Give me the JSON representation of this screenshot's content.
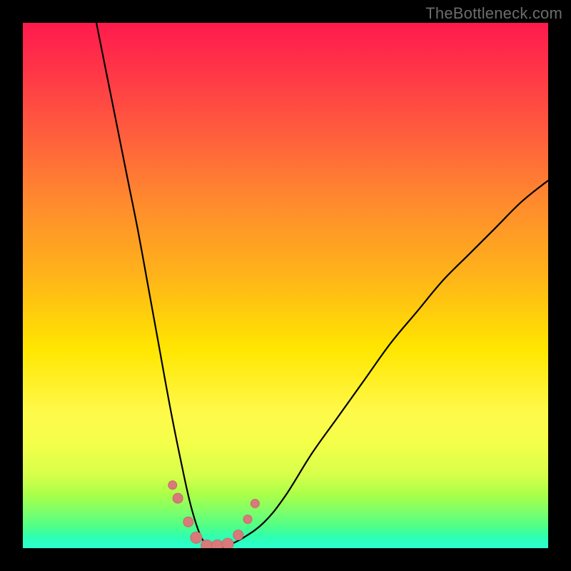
{
  "watermark": {
    "text": "TheBottleneck.com"
  },
  "colors": {
    "background": "#000000",
    "curve": "#000000",
    "marker_fill": "#d97a7a",
    "marker_stroke": "#c86a6a"
  },
  "chart_data": {
    "type": "line",
    "title": "",
    "xlabel": "",
    "ylabel": "",
    "xlim": [
      0,
      100
    ],
    "ylim": [
      0,
      100
    ],
    "grid": false,
    "legend": false,
    "notes": "Bottleneck-style V curve. Steep left arm and shallow right arm meeting near x≈35. High y = red/bad, low y (near 0) = green/good. No axis ticks or labels visible.",
    "series": [
      {
        "name": "left-arm",
        "x": [
          14,
          16,
          18,
          20,
          22,
          24,
          26,
          28,
          30,
          32,
          34,
          36,
          38
        ],
        "y": [
          100,
          90,
          80,
          70,
          60,
          49,
          38,
          27,
          17,
          8,
          2,
          0,
          0
        ]
      },
      {
        "name": "right-arm",
        "x": [
          38,
          42,
          46,
          50,
          55,
          60,
          65,
          70,
          75,
          80,
          85,
          90,
          95,
          100
        ],
        "y": [
          0,
          2,
          5,
          10,
          18,
          25,
          32,
          39,
          45,
          51,
          56,
          61,
          66,
          70
        ]
      }
    ],
    "markers": {
      "name": "near-optimal-points",
      "x": [
        28.5,
        29.5,
        31.5,
        33.0,
        35.0,
        37.0,
        39.0,
        41.0,
        42.8,
        44.2
      ],
      "y": [
        12.0,
        9.5,
        5.0,
        2.0,
        0.5,
        0.5,
        0.8,
        2.5,
        5.5,
        8.5
      ],
      "r": [
        6,
        7,
        7,
        8,
        8,
        8,
        8,
        7,
        6,
        6
      ]
    }
  }
}
